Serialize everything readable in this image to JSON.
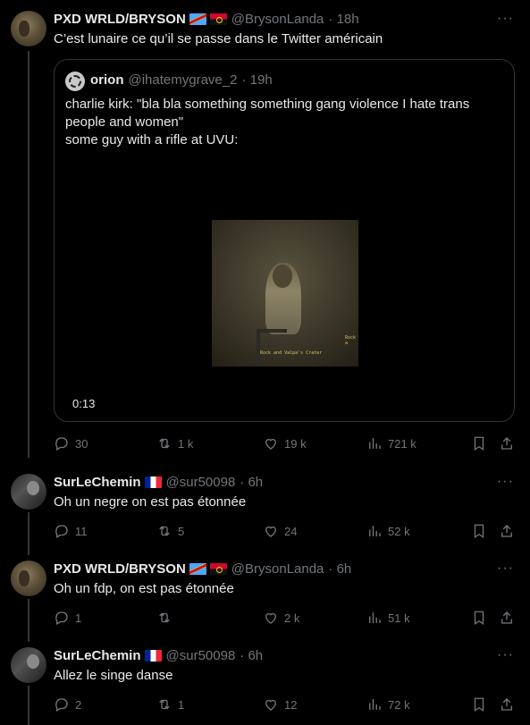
{
  "tweets": [
    {
      "name": "PXD WRLD/BRYSON",
      "handle": "@BrysonLanda",
      "time": "· 18h",
      "text": "C’est lunaire ce qu’il se passe dans le Twitter américain",
      "more": "···",
      "replies": "30",
      "retweets": "1 k",
      "likes": "19 k",
      "views": "721 k"
    },
    {
      "name": "SurLeChemin",
      "handle": "@sur50098",
      "time": "· 6h",
      "text": "Oh un negre on est pas étonnée",
      "more": "···",
      "replies": "11",
      "retweets": "5",
      "likes": "24",
      "views": "52 k"
    },
    {
      "name": "PXD WRLD/BRYSON",
      "handle": "@BrysonLanda",
      "time": "· 6h",
      "text": "Oh un fdp, on est pas étonnée",
      "more": "···",
      "replies": "1",
      "retweets": "",
      "likes": "2 k",
      "views": "51 k"
    },
    {
      "name": "SurLeChemin",
      "handle": "@sur50098",
      "time": "· 6h",
      "text": "Allez le singe danse",
      "more": "···",
      "replies": "2",
      "retweets": "1",
      "likes": "12",
      "views": "72 k"
    }
  ],
  "quote": {
    "name": "orion",
    "handle": "@ihatemygrave_2",
    "time": "· 19h",
    "line1": "charlie kirk: \"bla bla something something gang violence I hate trans people and women\"",
    "line2": "some guy with a rifle at UVU:",
    "video_caption_1": "Rock and Valpa's Crater",
    "video_caption_2": "Rock a",
    "duration": "0:13"
  },
  "icons": {
    "reply": "reply-icon",
    "retweet": "retweet-icon",
    "like": "heart-icon",
    "views": "views-icon",
    "bookmark": "bookmark-icon",
    "share": "share-icon"
  },
  "colors": {
    "background": "#000000",
    "text": "#e7e9ea",
    "muted": "#71767b",
    "border": "#2f3336"
  }
}
